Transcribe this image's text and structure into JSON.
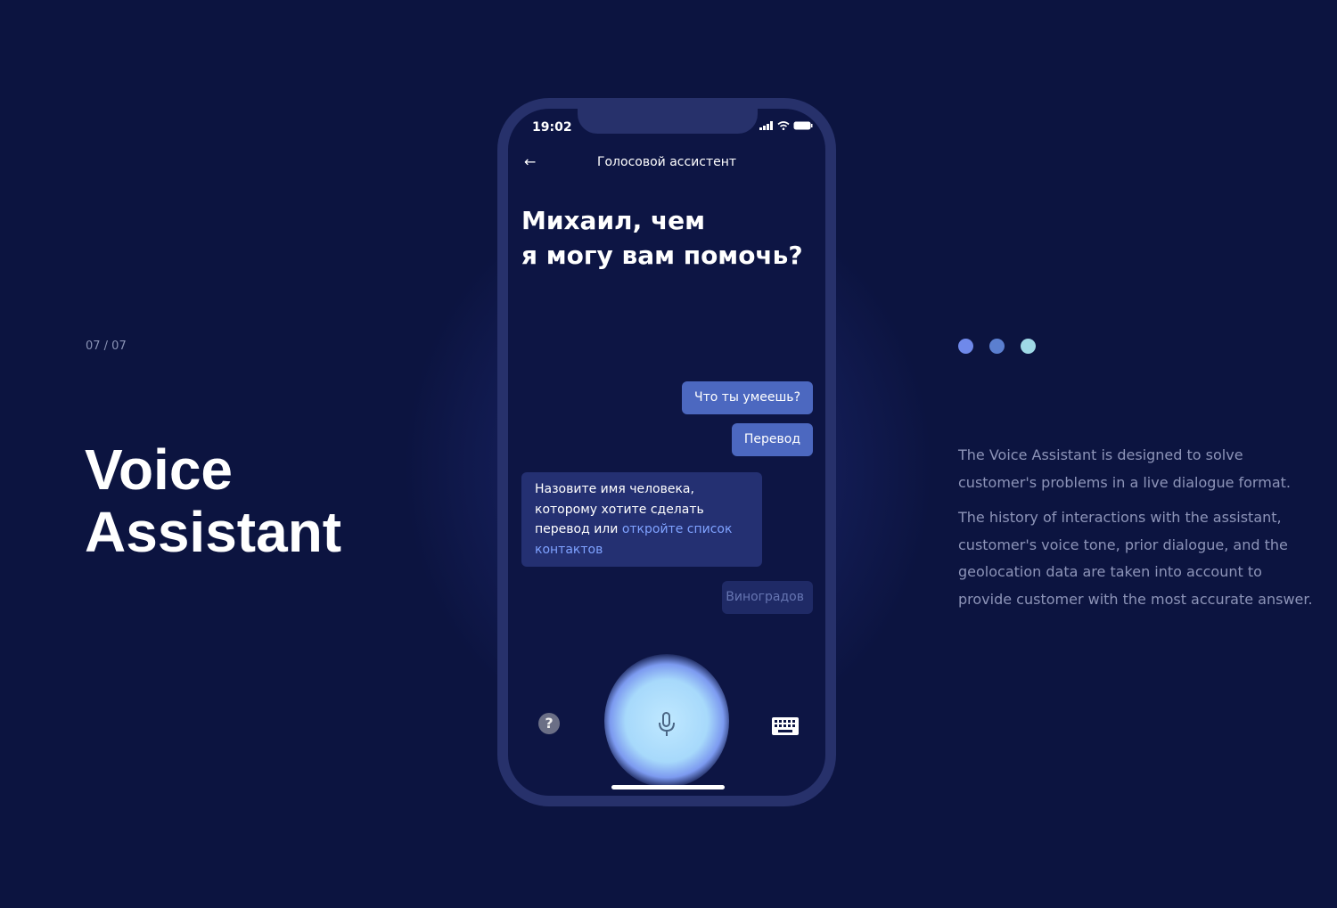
{
  "slide": {
    "counter": "07 / 07",
    "title_line1": "Voice",
    "title_line2": "Assistant"
  },
  "indicator_dots": [
    "#6f89ea",
    "#5b7fd0",
    "#9fd9e6"
  ],
  "description": {
    "paragraph1": "The Voice Assistant is designed to solve customer's problems in a live dialogue format.",
    "paragraph2": "The history of interactions with the assistant, customer's voice tone, prior dialogue, and the geolocation data are taken into account to provide customer with the most accurate answer."
  },
  "phone": {
    "status_time": "19:02",
    "nav_title": "Голосовой ассистент",
    "greeting_line1": "Михаил, чем",
    "greeting_line2": "я могу вам помочь?",
    "messages": {
      "user1": "Что ты умеешь?",
      "user2": "Перевод",
      "bot_text": "Назовите имя человека, которому хотите сделать перевод или ",
      "bot_link": "откройте список контактов",
      "user_typing": "Виноградов"
    },
    "help_glyph": "?",
    "icons": [
      "back-arrow-icon",
      "signal-icon",
      "wifi-icon",
      "battery-icon",
      "help-icon",
      "microphone-icon",
      "keyboard-icon"
    ],
    "colors": {
      "bubble_user": "#4c68c0",
      "bubble_bot": "#243072",
      "link": "#7fa2ff",
      "glow": "#a7d9fb"
    }
  }
}
